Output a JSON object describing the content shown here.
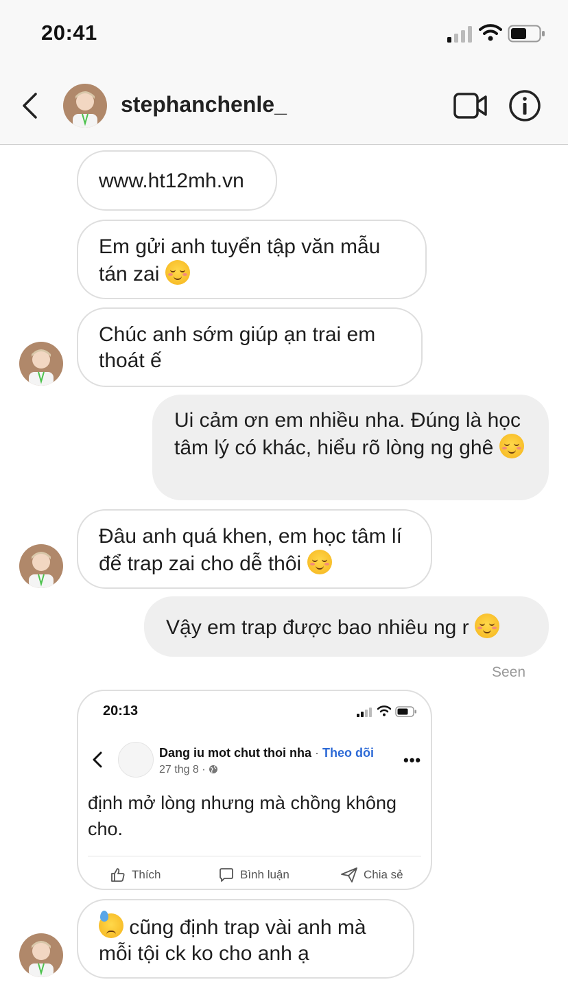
{
  "status_bar": {
    "time": "20:41"
  },
  "header": {
    "username": "stephanchenle_"
  },
  "messages": [
    {
      "text": "www.ht12mh.vn"
    },
    {
      "text": "Em gửi anh tuyển tập văn mẫu tán zai",
      "emoji": "relieved-smile-emoji"
    },
    {
      "text": "Chúc anh sớm giúp ạn trai em thoát ế"
    },
    {
      "text": "Ui cảm ơn em nhiều nha. Đúng là học tâm lý có khác, hiểu rõ lòng ng ghê",
      "emoji": "relieved-smile-emoji"
    },
    {
      "text": "Đâu anh quá khen, em học tâm lí để trap zai cho dễ thôi",
      "emoji": "relieved-smile-emoji"
    },
    {
      "text": "Vậy em trap được bao nhiêu ng r",
      "emoji": "relieved-smile-emoji"
    },
    {
      "text": "cũng định trap vài anh mà mỗi tội ck ko cho anh ạ",
      "emoji": "sweat-emoji"
    }
  ],
  "seen_label": "Seen",
  "shared_post": {
    "time": "20:13",
    "page_name": "Dang iu mot chut thoi nha",
    "separator": " · ",
    "follow_label": "Theo dõi",
    "date": "27 thg 8 ·",
    "text": "định mở lòng nhưng mà chồng không cho.",
    "like_label": "Thích",
    "comment_label": "Bình luận",
    "share_label": "Chia sẻ"
  }
}
